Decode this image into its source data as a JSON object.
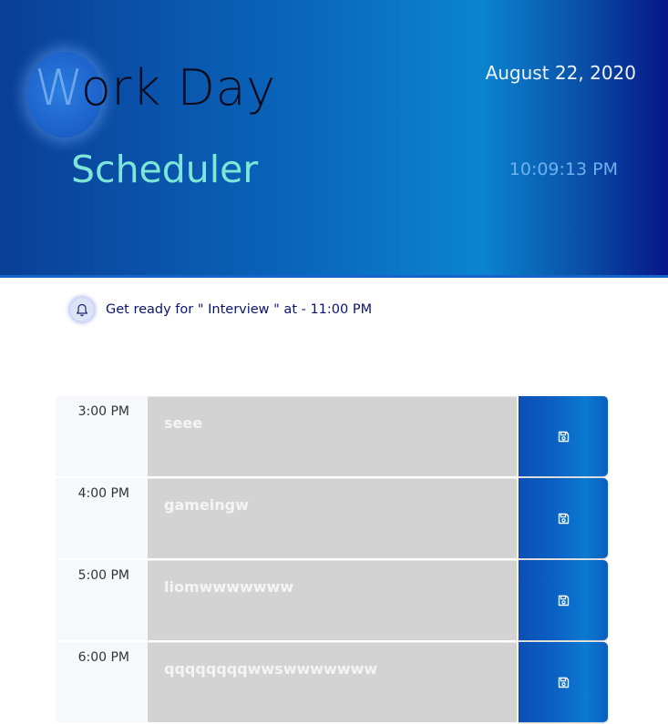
{
  "header": {
    "title_initial": "W",
    "title_rest": "ork Day",
    "subtitle": "Scheduler",
    "date": "August 22, 2020",
    "time": "10:09:13 PM"
  },
  "reminder": {
    "icon": "bell-icon",
    "text": "Get ready for \" Interview \" at - 11:00 PM"
  },
  "schedule": {
    "rows": [
      {
        "hour": "3:00 PM",
        "task": "seee",
        "save_icon": "floppy-disk-icon"
      },
      {
        "hour": "4:00 PM",
        "task": "gameingw",
        "save_icon": "floppy-disk-icon"
      },
      {
        "hour": "5:00 PM",
        "task": "liomwwwwwww",
        "save_icon": "floppy-disk-icon"
      },
      {
        "hour": "6:00 PM",
        "task": "qqqqqqqqwwswwwwwww",
        "save_icon": "floppy-disk-icon"
      }
    ]
  },
  "colors": {
    "header_dark": "#0a3f96",
    "header_light": "#0b84d0",
    "subtitle": "#7ee6d8",
    "task_bg": "#d3d3d3",
    "reminder_text": "#0a1470"
  }
}
